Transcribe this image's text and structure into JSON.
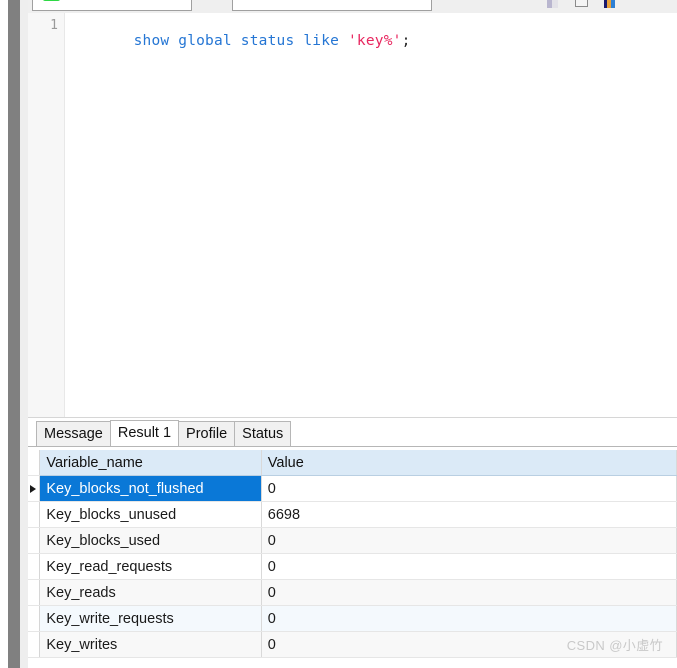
{
  "toolbar": {
    "connection_field_value": "",
    "connection_field_placeholder": "",
    "database_field_value": "",
    "database_field_placeholder": "",
    "icons": [
      "run-icon",
      "text-cursor-icon",
      "stop-icon",
      "color-palette-icon"
    ]
  },
  "editor": {
    "line_number": "1",
    "tokens": [
      {
        "text": "show",
        "type": "keyword"
      },
      {
        "text": " ",
        "type": "plain"
      },
      {
        "text": "global",
        "type": "keyword"
      },
      {
        "text": " ",
        "type": "plain"
      },
      {
        "text": "status",
        "type": "keyword"
      },
      {
        "text": " ",
        "type": "plain"
      },
      {
        "text": "like",
        "type": "keyword"
      },
      {
        "text": " ",
        "type": "plain"
      },
      {
        "text": "'key%'",
        "type": "string"
      },
      {
        "text": ";",
        "type": "punct"
      }
    ],
    "statement": "show global status like 'key%';"
  },
  "results": {
    "tabs": [
      {
        "label": "Message",
        "active": false
      },
      {
        "label": "Result 1",
        "active": true
      },
      {
        "label": "Profile",
        "active": false
      },
      {
        "label": "Status",
        "active": false
      }
    ],
    "columns": [
      "Variable_name",
      "Value"
    ],
    "rows": [
      {
        "name": "Key_blocks_not_flushed",
        "value": "0",
        "selected": true
      },
      {
        "name": "Key_blocks_unused",
        "value": "6698",
        "selected": false
      },
      {
        "name": "Key_blocks_used",
        "value": "0",
        "selected": false
      },
      {
        "name": "Key_read_requests",
        "value": "0",
        "selected": false
      },
      {
        "name": "Key_reads",
        "value": "0",
        "selected": false
      },
      {
        "name": "Key_write_requests",
        "value": "0",
        "selected": false
      },
      {
        "name": "Key_writes",
        "value": "0",
        "selected": false
      }
    ]
  },
  "watermark": {
    "text": "CSDN @小虚竹"
  },
  "colors": {
    "selection_blue": "#0a78d7",
    "header_blue": "#dbeaf7",
    "keyword_blue": "#2576d4",
    "string_red": "#e8275f",
    "frame_gray": "#808080"
  }
}
